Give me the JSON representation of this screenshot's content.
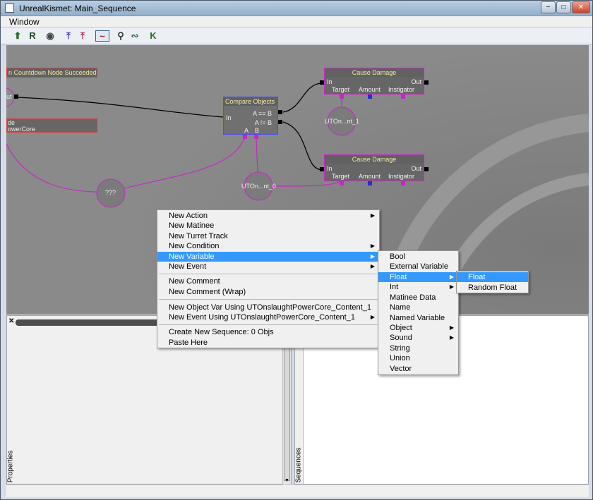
{
  "window": {
    "title": "UnrealKismet: Main_Sequence",
    "minimize": "−",
    "maximize": "□",
    "close": "✕"
  },
  "menubar": {
    "window_label": "Window"
  },
  "toolbar": {
    "icons": [
      "up-arrow-icon",
      "r-icon",
      "eye-icon",
      "flow-in-icon",
      "flow-out-icon",
      "graph-icon",
      "zoom-icon",
      "link-icon",
      "kismet-icon"
    ]
  },
  "graph": {
    "countdown_title": "n Countdown Node Succeeded",
    "countdown_out": "ut",
    "left_node_line1": "de",
    "left_node_line2": "owerCore",
    "compare": {
      "title": "Compare Objects",
      "in": "In",
      "eq": "A == B",
      "neq": "A != B",
      "a": "A",
      "b": "B"
    },
    "damage1": {
      "title": "Cause Damage",
      "in": "In",
      "out": "Out",
      "target": "Target",
      "amount": "Amount",
      "instigator": "Instigator"
    },
    "damage2": {
      "title": "Cause Damage",
      "in": "In",
      "out": "Out",
      "target": "Target",
      "amount": "Amount",
      "instigator": "Instigator"
    },
    "var_unknown": "???",
    "var_top": "UTOn...nt_1",
    "var_mid": "UTOn...nt_0"
  },
  "context_menu": {
    "items": [
      "New Action",
      "New Matinee",
      "New Turret Track",
      "New Condition",
      "New Variable",
      "New Event",
      "New Comment",
      "New Comment (Wrap)",
      "New Object Var Using UTOnslaughtPowerCore_Content_1",
      "New Event Using UTOnslaughtPowerCore_Content_1",
      "Create New Sequence: 0 Objs",
      "Paste Here"
    ]
  },
  "variable_menu": {
    "items": [
      "Bool",
      "External Variable",
      "Float",
      "Int",
      "Matinee Data",
      "Name",
      "Named Variable",
      "Object",
      "Sound",
      "String",
      "Union",
      "Vector"
    ]
  },
  "float_menu": {
    "items": [
      "Float",
      "Random Float"
    ]
  },
  "panels": {
    "properties": "Properties",
    "sequences": "Sequences",
    "close": "✕"
  },
  "colors": {
    "highlight": "#3399ff",
    "pink": "#c22bc2",
    "compare_border": "#4a50e0"
  }
}
